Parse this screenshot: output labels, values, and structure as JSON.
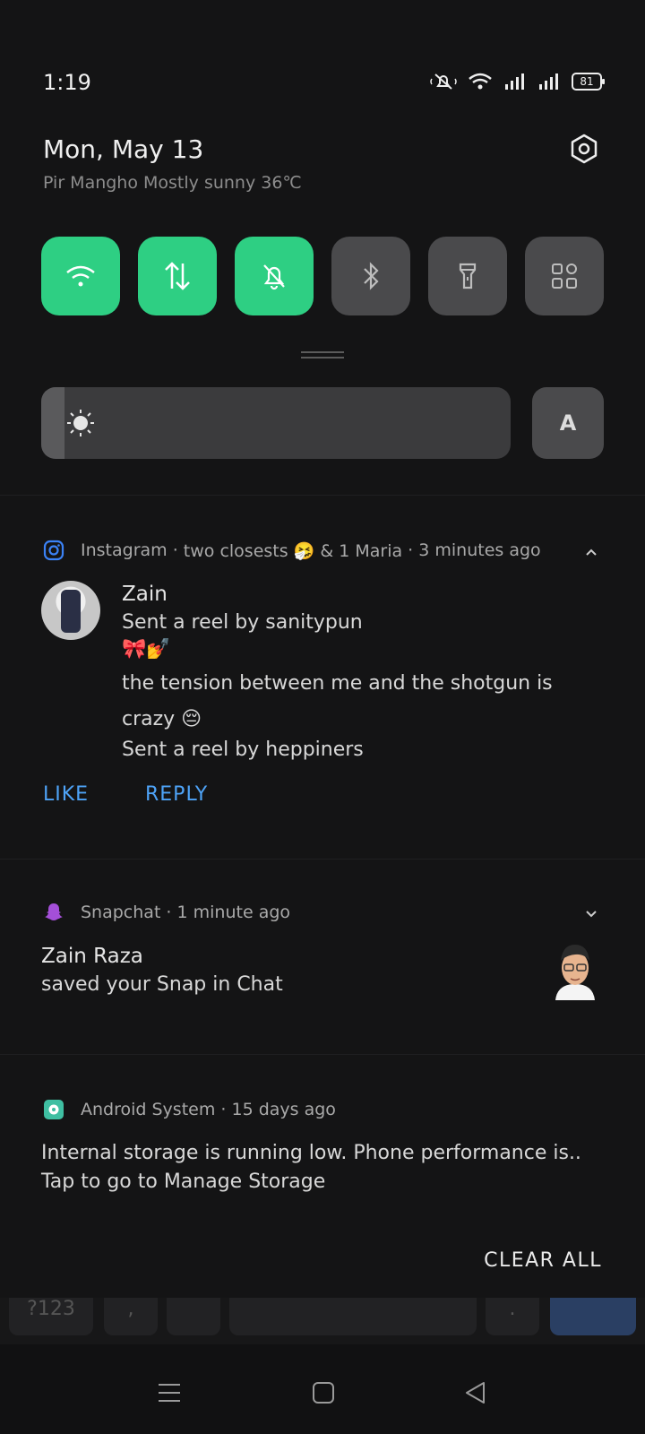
{
  "status_bar": {
    "time": "1:19",
    "battery": "81",
    "icons": [
      "mute-bell-icon",
      "wifi-icon",
      "signal-icon",
      "signal-icon"
    ]
  },
  "header": {
    "date": "Mon, May 13",
    "weather": "Pir Mangho Mostly sunny 36℃",
    "settings_icon": "gear-icon"
  },
  "quick_tiles": [
    {
      "name": "wifi",
      "icon": "wifi-icon",
      "active": true
    },
    {
      "name": "mobile-data",
      "icon": "data-arrows-icon",
      "active": true
    },
    {
      "name": "silent",
      "icon": "bell-off-icon",
      "active": true
    },
    {
      "name": "bluetooth",
      "icon": "bluetooth-icon",
      "active": false
    },
    {
      "name": "flashlight",
      "icon": "flashlight-icon",
      "active": false
    },
    {
      "name": "more-tiles",
      "icon": "grid-icon",
      "active": false
    }
  ],
  "brightness": {
    "level": 0.05,
    "auto_label": "A"
  },
  "notifications": {
    "instagram": {
      "app": "Instagram",
      "thread": "two closests 🤧 & 1 Maria",
      "time": "3 minutes ago",
      "sender": "Zain",
      "lines": [
        "Sent a reel by sanitypun",
        "🎀💅",
        "the tension between me and the shotgun is",
        "crazy 😔",
        "Sent a reel by heppiners"
      ],
      "actions": [
        "LIKE",
        "REPLY"
      ]
    },
    "snapchat": {
      "app": "Snapchat",
      "time": "1 minute ago",
      "title": "Zain Raza",
      "body": "saved your Snap in Chat"
    },
    "android": {
      "app": "Android System",
      "time": "15 days ago",
      "title": "Internal storage is running low. Phone performance is..",
      "body": "Tap to go to Manage Storage"
    }
  },
  "clear_all": "CLEAR ALL",
  "keyboard_peek": {
    "key_123": "?123",
    "key_comma": ",",
    "key_period": "."
  },
  "colors": {
    "accent_green": "#2ecf83",
    "tile_off": "#4a4a4c",
    "action_blue": "#4ea3f7"
  }
}
